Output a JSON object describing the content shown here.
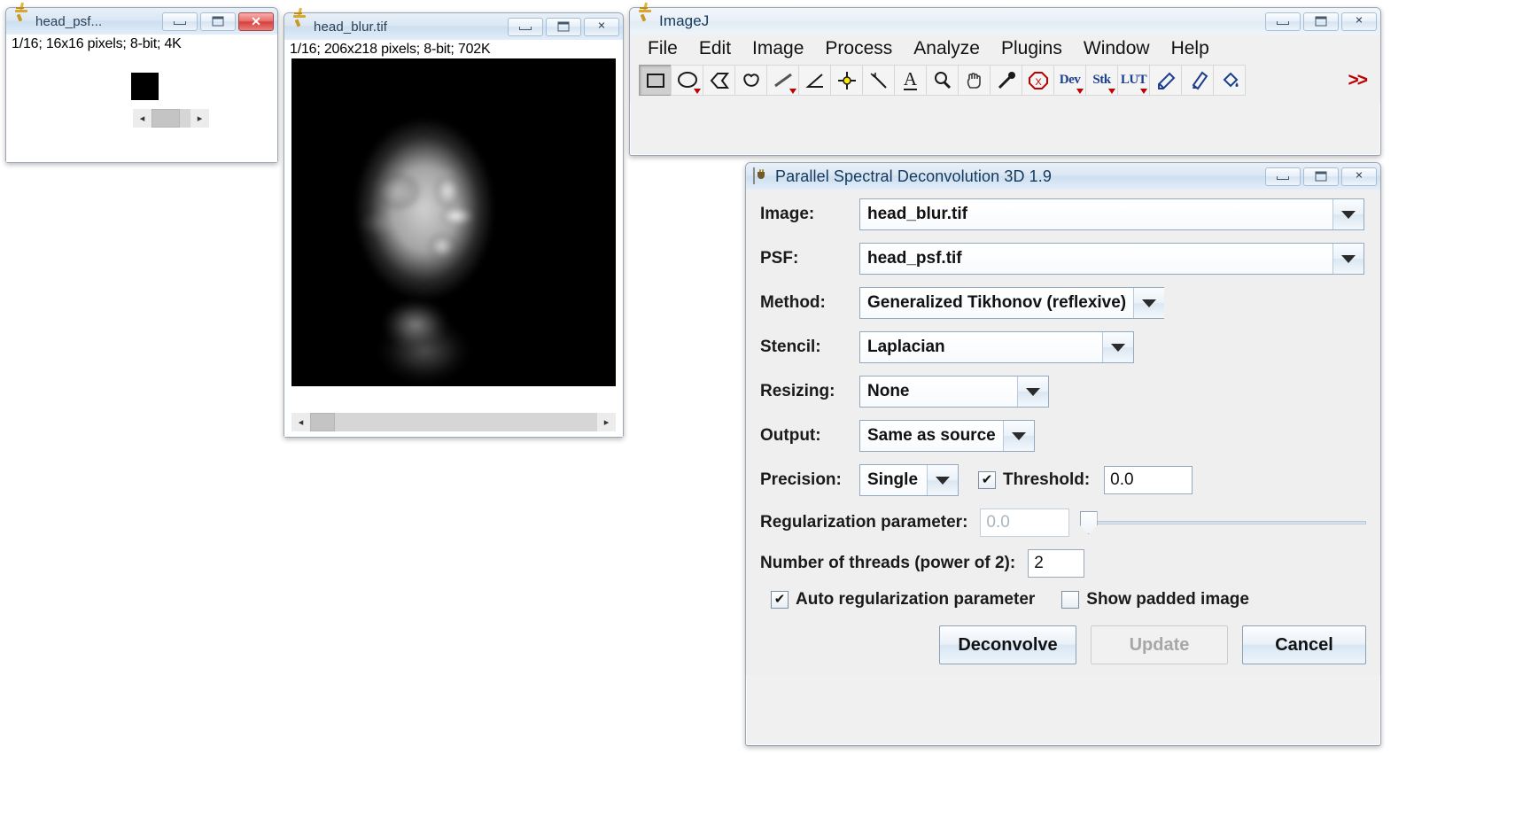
{
  "psf_window": {
    "title": "head_psf...",
    "status": "1/16; 16x16 pixels; 8-bit; 4K",
    "icon": "microscope-icon",
    "minimize_label": "",
    "maximize_label": "",
    "close_label": "✕",
    "scroll_left_label": "◂",
    "scroll_right_label": "▸"
  },
  "blur_window": {
    "title": "head_blur.tif",
    "status": "1/16; 206x218 pixels; 8-bit; 702K",
    "icon": "microscope-icon",
    "close_label": "✕",
    "scroll_left_label": "◂",
    "scroll_right_label": "▸"
  },
  "imagej": {
    "title": "ImageJ",
    "icon": "microscope-icon",
    "close_label": "✕",
    "menus": [
      "File",
      "Edit",
      "Image",
      "Process",
      "Analyze",
      "Plugins",
      "Window",
      "Help"
    ],
    "tools": [
      {
        "name": "rectangle-tool",
        "label": "",
        "selected": true,
        "dropdown": false
      },
      {
        "name": "oval-tool",
        "label": "",
        "selected": false,
        "dropdown": true
      },
      {
        "name": "polygon-tool",
        "label": "",
        "selected": false,
        "dropdown": false
      },
      {
        "name": "freehand-tool",
        "label": "",
        "selected": false,
        "dropdown": false
      },
      {
        "name": "line-tool",
        "label": "",
        "selected": false,
        "dropdown": true
      },
      {
        "name": "angle-tool",
        "label": "",
        "selected": false,
        "dropdown": false
      },
      {
        "name": "point-tool",
        "label": "",
        "selected": false,
        "dropdown": false
      },
      {
        "name": "wand-tool",
        "label": "",
        "selected": false,
        "dropdown": false
      },
      {
        "name": "text-tool",
        "label": "A",
        "selected": false,
        "dropdown": false
      },
      {
        "name": "magnifier-tool",
        "label": "",
        "selected": false,
        "dropdown": false
      },
      {
        "name": "hand-tool",
        "label": "",
        "selected": false,
        "dropdown": false
      },
      {
        "name": "dropper-tool",
        "label": "",
        "selected": false,
        "dropdown": false
      },
      {
        "name": "stop-tool",
        "label": "",
        "selected": false,
        "dropdown": false
      },
      {
        "name": "dev-tool",
        "label": "Dev",
        "selected": false,
        "dropdown": true
      },
      {
        "name": "stk-tool",
        "label": "Stk",
        "selected": false,
        "dropdown": true
      },
      {
        "name": "lut-tool",
        "label": "LUT",
        "selected": false,
        "dropdown": true
      },
      {
        "name": "pencil-tool",
        "label": "",
        "selected": false,
        "dropdown": false
      },
      {
        "name": "brush-tool",
        "label": "",
        "selected": false,
        "dropdown": false
      },
      {
        "name": "flood-fill-tool",
        "label": "",
        "selected": false,
        "dropdown": false
      }
    ],
    "overflow_label": ">>"
  },
  "dialog": {
    "title": "Parallel Spectral Deconvolution 3D 1.9",
    "icon": "java-cup-icon",
    "close_label": "✕",
    "fields": {
      "image_label": "Image:",
      "image_value": "head_blur.tif",
      "psf_label": "PSF:",
      "psf_value": "head_psf.tif",
      "method_label": "Method:",
      "method_value": "Generalized Tikhonov (reflexive)",
      "stencil_label": "Stencil:",
      "stencil_value": "Laplacian",
      "resizing_label": "Resizing:",
      "resizing_value": "None",
      "output_label": "Output:",
      "output_value": "Same as source",
      "precision_label": "Precision:",
      "precision_value": "Single",
      "threshold_label": "Threshold:",
      "threshold_value": "0.0",
      "threshold_checked": true,
      "regularization_label": "Regularization parameter:",
      "regularization_value": "0.0",
      "threads_label": "Number of threads (power of 2):",
      "threads_value": "2",
      "auto_reg_label": "Auto regularization parameter",
      "auto_reg_checked": true,
      "show_padded_label": "Show padded image",
      "show_padded_checked": false
    },
    "buttons": {
      "deconvolve": "Deconvolve",
      "update": "Update",
      "cancel": "Cancel"
    }
  },
  "colors": {
    "window_bg": "#f0f0f0",
    "title_blue": "#14395c",
    "close_red": "#d8403c",
    "tool_blue": "#1c3f8f",
    "tool_red": "#c00000"
  }
}
